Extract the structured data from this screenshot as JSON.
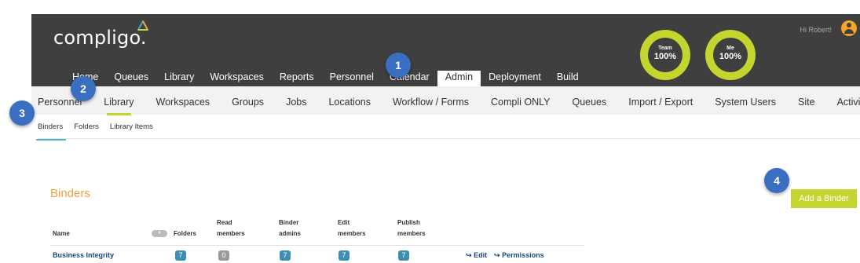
{
  "brand": {
    "logo_text": "compligo."
  },
  "header": {
    "greeting": "Hi Robert!",
    "gauges": [
      {
        "label": "Team",
        "value": "100%"
      },
      {
        "label": "Me",
        "value": "100%"
      }
    ],
    "gauge_color": "#c5d52f"
  },
  "main_nav": {
    "items": [
      "Home",
      "Queues",
      "Library",
      "Workspaces",
      "Reports",
      "Personnel",
      "Calendar",
      "Admin",
      "Deployment",
      "Build"
    ],
    "active": "Admin"
  },
  "admin_nav": {
    "items": [
      "Personnel",
      "Library",
      "Workspaces",
      "Groups",
      "Jobs",
      "Locations",
      "Workflow / Forms",
      "Compli ONLY",
      "Queues",
      "Import / Export",
      "System Users",
      "Site",
      "Activity Manifest"
    ],
    "active": "Library"
  },
  "library_tabs": {
    "items": [
      "Binders",
      "Folders",
      "Library Items"
    ],
    "active": "Binders"
  },
  "binders": {
    "title": "Binders",
    "add_button": "Add a Binder",
    "name_count": "4",
    "columns": {
      "name": "Name",
      "folders": "Folders",
      "read_members": [
        "Read",
        "members"
      ],
      "binder_admins": [
        "Binder",
        "admins"
      ],
      "edit_members": [
        "Edit",
        "members"
      ],
      "publish_members": [
        "Publish",
        "members"
      ]
    },
    "rows": [
      {
        "name": "Business Integrity",
        "folders": "7",
        "read_members": "0",
        "binder_admins": "7",
        "edit_members": "7",
        "publish_members": "7",
        "edit_label": "Edit",
        "permissions_label": "Permissions"
      }
    ]
  },
  "callouts": [
    "1",
    "2",
    "3",
    "4"
  ],
  "colors": {
    "accent": "#c5d52f",
    "title": "#f0a23a",
    "link": "#1b4a7a",
    "badge": "#3d8fb0",
    "callout": "#3a6ec0",
    "header": "#3f3f3f"
  }
}
